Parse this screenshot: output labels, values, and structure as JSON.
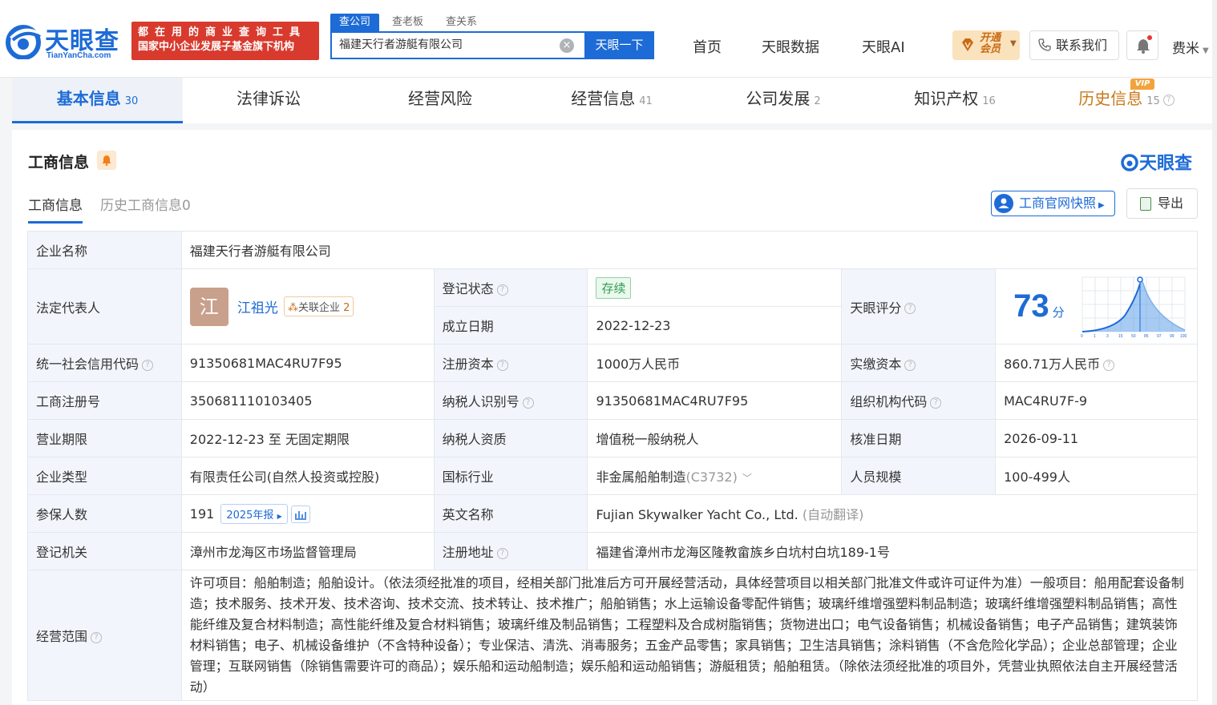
{
  "brand": {
    "name": "天眼查",
    "domain": "TianYanCha.com",
    "slogan_line1": "都在用的商业查询工具",
    "slogan_line2": "国家中小企业发展子基金旗下机构"
  },
  "search": {
    "tabs": [
      "查公司",
      "查老板",
      "查关系"
    ],
    "value": "福建天行者游艇有限公司",
    "button": "天眼一下"
  },
  "nav": {
    "items": [
      "首页",
      "天眼数据",
      "天眼AI"
    ],
    "vip_line1": "开通",
    "vip_line2": "会员",
    "contact": "联系我们",
    "user": "费米"
  },
  "main_tabs": [
    {
      "label": "基本信息",
      "count": "30"
    },
    {
      "label": "法律诉讼",
      "count": ""
    },
    {
      "label": "经营风险",
      "count": ""
    },
    {
      "label": "经营信息",
      "count": "41"
    },
    {
      "label": "公司发展",
      "count": "2"
    },
    {
      "label": "知识产权",
      "count": "16"
    },
    {
      "label": "历史信息",
      "count": "15"
    }
  ],
  "vip_tag": "VIP",
  "section": {
    "title": "工商信息",
    "brand": "天眼查",
    "subtabs": [
      "工商信息",
      "历史工商信息0"
    ],
    "snapshot_btn": "工商官网快照",
    "export_btn": "导出"
  },
  "info": {
    "company_name_label": "企业名称",
    "company_name": "福建天行者游艇有限公司",
    "legal_rep_label": "法定代表人",
    "legal_rep_avatar": "江",
    "legal_rep": "江祖光",
    "related_label": "关联企业",
    "related_count": "2",
    "reg_status_label": "登记状态",
    "reg_status": "存续",
    "found_date_label": "成立日期",
    "found_date": "2022-12-23",
    "score_label": "天眼评分",
    "score": "73",
    "score_unit": "分",
    "credit_code_label": "统一社会信用代码",
    "credit_code": "91350681MAC4RU7F95",
    "reg_capital_label": "注册资本",
    "reg_capital": "1000万人民币",
    "paid_capital_label": "实缴资本",
    "paid_capital": "860.71万人民币",
    "reg_no_label": "工商注册号",
    "reg_no": "350681110103405",
    "taxpayer_id_label": "纳税人识别号",
    "taxpayer_id": "91350681MAC4RU7F95",
    "org_code_label": "组织机构代码",
    "org_code": "MAC4RU7F-9",
    "term_label": "营业期限",
    "term": "2022-12-23 至 无固定期限",
    "tax_quality_label": "纳税人资质",
    "tax_quality": "增值税一般纳税人",
    "approve_date_label": "核准日期",
    "approve_date": "2026-09-11",
    "type_label": "企业类型",
    "type": "有限责任公司(自然人投资或控股)",
    "industry_label": "国标行业",
    "industry": "非金属船舶制造",
    "industry_code": "(C3732)",
    "staff_label": "人员规模",
    "staff": "100-499人",
    "insured_label": "参保人数",
    "insured": "191",
    "annual_report": "2025年报",
    "en_name_label": "英文名称",
    "en_name": "Fujian Skywalker Yacht Co., Ltd.",
    "en_name_note": "(自动翻译)",
    "authority_label": "登记机关",
    "authority": "漳州市龙海区市场监督管理局",
    "address_label": "注册地址",
    "address": "福建省漳州市龙海区隆教畲族乡白坑村白坑189-1号",
    "scope_label": "经营范围",
    "scope": "许可项目：船舶制造；船舶设计。（依法须经批准的项目，经相关部门批准后方可开展经营活动，具体经营项目以相关部门批准文件或许可证件为准）一般项目：船用配套设备制造；技术服务、技术开发、技术咨询、技术交流、技术转让、技术推广；船舶销售；水上运输设备零配件销售；玻璃纤维增强塑料制品制造；玻璃纤维增强塑料制品销售；高性能纤维及复合材料制造；高性能纤维及复合材料销售；玻璃纤维及制品销售；工程塑料及合成树脂销售；货物进出口；电气设备销售；机械设备销售；电子产品销售；建筑装饰材料销售；电子、机械设备维护（不含特种设备）；专业保洁、清洗、消毒服务；五金产品零售；家具销售；卫生洁具销售；涂料销售（不含危险化学品）；企业总部管理；企业管理；互联网销售（除销售需要许可的商品）；娱乐船和运动船制造；娱乐船和运动船销售；游艇租赁；船舶租赁。（除依法须经批准的项目外，凭营业执照依法自主开展经营活动）"
  },
  "score_chart": {
    "ticks": [
      "0",
      "1",
      "3",
      "15",
      "50",
      "85",
      "97",
      "99",
      "100"
    ]
  },
  "colors": {
    "brand_blue": "#1d6bd6",
    "slogan_red": "#d83a2d",
    "vip_gold": "#c86b14"
  }
}
